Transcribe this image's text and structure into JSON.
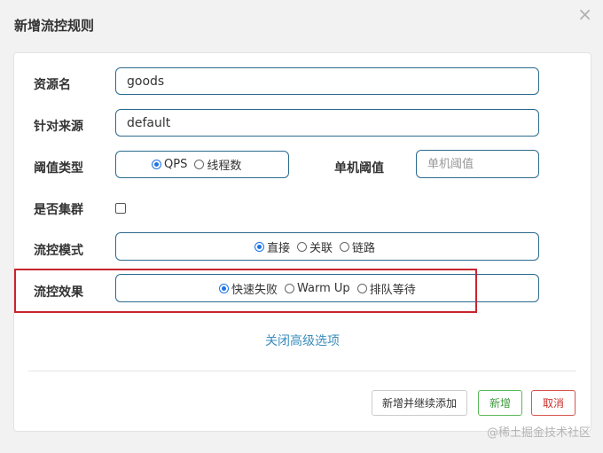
{
  "dialog": {
    "title": "新增流控规则",
    "close_icon": "×"
  },
  "form": {
    "resource_label": "资源名",
    "resource_value": "goods",
    "source_label": "针对来源",
    "source_value": "default",
    "threshold_type_label": "阈值类型",
    "threshold_type_options": [
      "QPS",
      "线程数"
    ],
    "threshold_type_selected": "QPS",
    "single_threshold_label": "单机阈值",
    "single_threshold_placeholder": "单机阈值",
    "cluster_label": "是否集群",
    "cluster_checked": false,
    "mode_label": "流控模式",
    "mode_options": [
      "直接",
      "关联",
      "链路"
    ],
    "mode_selected": "直接",
    "effect_label": "流控效果",
    "effect_options": [
      "快速失败",
      "Warm Up",
      "排队等待"
    ],
    "effect_selected": "快速失败"
  },
  "advanced_link": "关闭高级选项",
  "buttons": {
    "add_continue": "新增并继续添加",
    "add": "新增",
    "cancel": "取消"
  },
  "watermark": "@稀土掘金技术社区",
  "colors": {
    "accent_border": "#2b6a8e",
    "highlight": "#c9252f",
    "link": "#3c8dbc"
  }
}
